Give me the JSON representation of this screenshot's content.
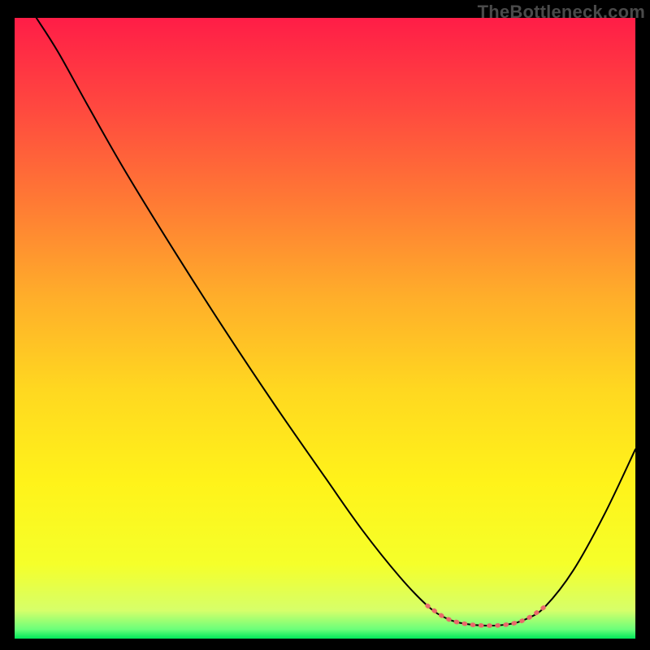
{
  "watermark": "TheBottleneck.com",
  "chart_data": {
    "type": "line",
    "title": "",
    "xlabel": "",
    "ylabel": "",
    "xlim": [
      0,
      100
    ],
    "ylim": [
      0,
      100
    ],
    "grid": false,
    "legend": false,
    "gradient_stops": [
      {
        "offset": 0.0,
        "color": "#ff1d47"
      },
      {
        "offset": 0.15,
        "color": "#ff4a3f"
      },
      {
        "offset": 0.3,
        "color": "#ff7b34"
      },
      {
        "offset": 0.45,
        "color": "#ffae2a"
      },
      {
        "offset": 0.6,
        "color": "#ffd820"
      },
      {
        "offset": 0.75,
        "color": "#fff31a"
      },
      {
        "offset": 0.88,
        "color": "#f5ff2a"
      },
      {
        "offset": 0.955,
        "color": "#d6ff6a"
      },
      {
        "offset": 0.985,
        "color": "#6bff7a"
      },
      {
        "offset": 1.0,
        "color": "#00e85a"
      }
    ],
    "series": [
      {
        "name": "bottleneck-curve",
        "style": {
          "stroke": "#000000",
          "width": 2.0,
          "dash": null
        },
        "points": [
          {
            "x": 3.5,
            "y": 100.0
          },
          {
            "x": 7.0,
            "y": 94.5
          },
          {
            "x": 12.0,
            "y": 85.5
          },
          {
            "x": 18.0,
            "y": 75.0
          },
          {
            "x": 26.0,
            "y": 62.0
          },
          {
            "x": 34.0,
            "y": 49.5
          },
          {
            "x": 42.0,
            "y": 37.5
          },
          {
            "x": 50.0,
            "y": 26.0
          },
          {
            "x": 56.0,
            "y": 17.5
          },
          {
            "x": 62.0,
            "y": 10.0
          },
          {
            "x": 66.5,
            "y": 5.3
          },
          {
            "x": 69.5,
            "y": 3.3
          },
          {
            "x": 72.5,
            "y": 2.4
          },
          {
            "x": 76.0,
            "y": 2.1
          },
          {
            "x": 79.5,
            "y": 2.3
          },
          {
            "x": 82.5,
            "y": 3.2
          },
          {
            "x": 85.5,
            "y": 5.2
          },
          {
            "x": 90.0,
            "y": 11.0
          },
          {
            "x": 95.0,
            "y": 20.0
          },
          {
            "x": 100.0,
            "y": 30.5
          }
        ]
      },
      {
        "name": "valley-marker",
        "style": {
          "stroke": "#e96a6a",
          "width": 5.5,
          "dash": "1.2 9"
        },
        "points": [
          {
            "x": 66.5,
            "y": 5.3
          },
          {
            "x": 69.5,
            "y": 3.3
          },
          {
            "x": 72.5,
            "y": 2.4
          },
          {
            "x": 76.0,
            "y": 2.1
          },
          {
            "x": 79.5,
            "y": 2.3
          },
          {
            "x": 82.5,
            "y": 3.2
          },
          {
            "x": 85.5,
            "y": 5.2
          }
        ]
      }
    ]
  }
}
